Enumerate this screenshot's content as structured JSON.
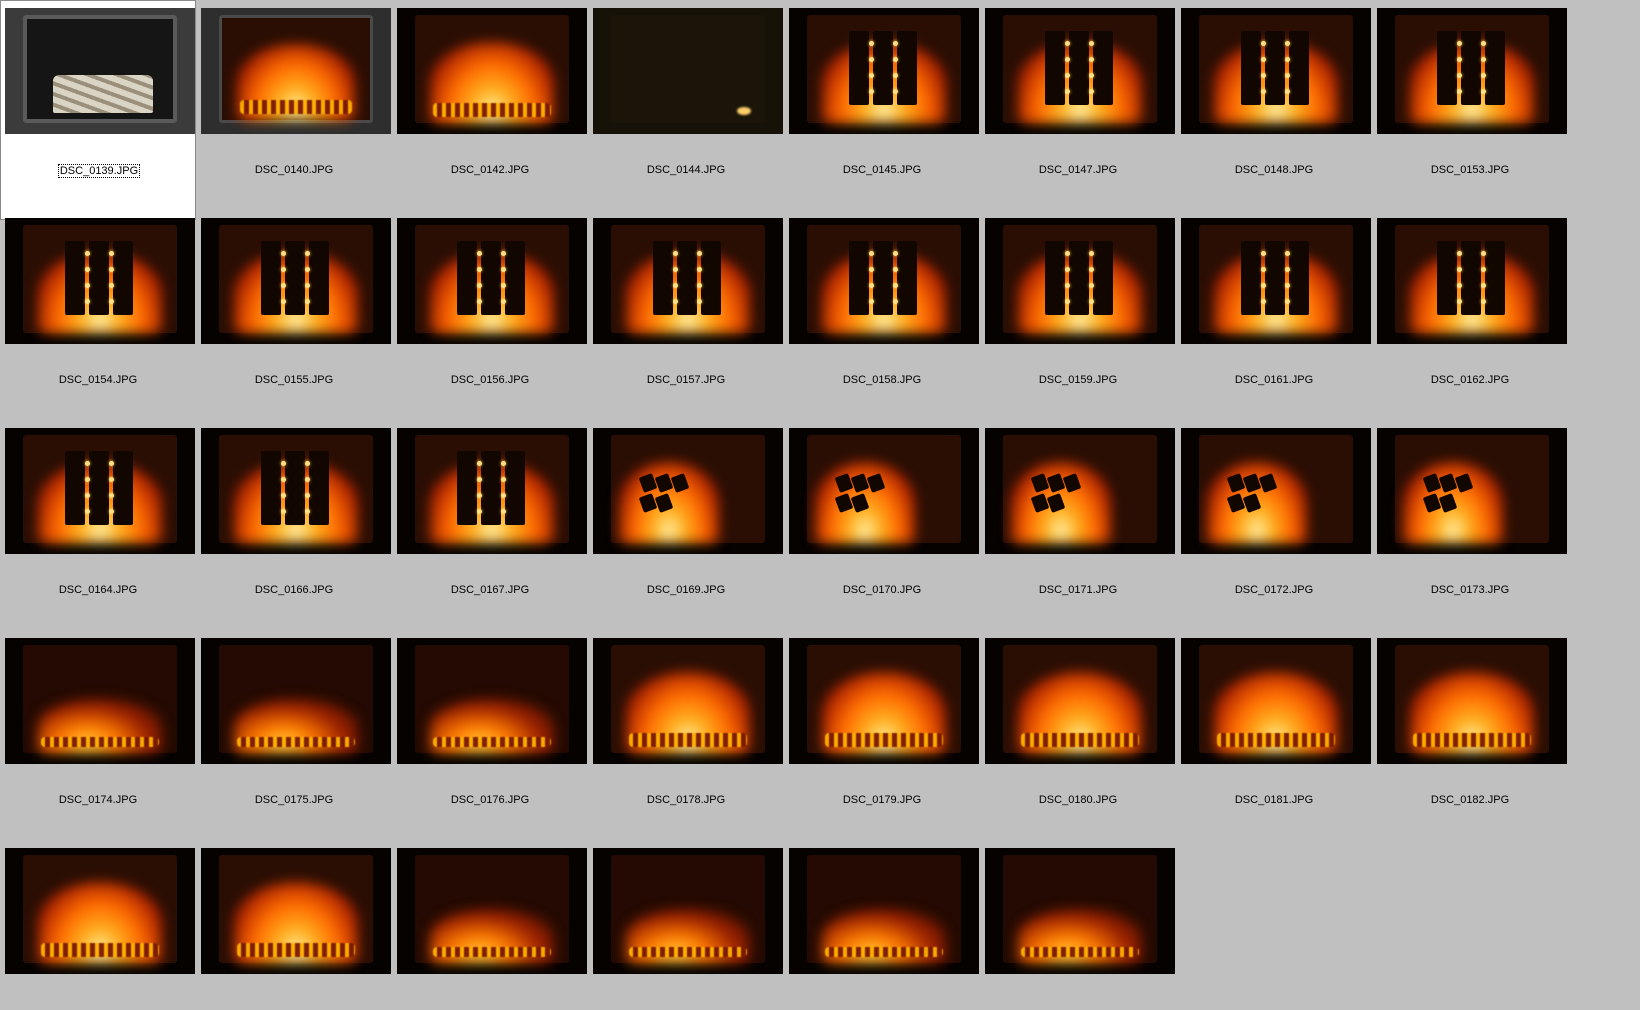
{
  "window": {
    "title": ""
  },
  "gallery": {
    "items": [
      {
        "name": "DSC_0139.JPG",
        "selected": true,
        "style": "wood"
      },
      {
        "name": "DSC_0140.JPG",
        "selected": false,
        "style": "startfire"
      },
      {
        "name": "DSC_0142.JPG",
        "selected": false,
        "style": "flame"
      },
      {
        "name": "DSC_0144.JPG",
        "selected": false,
        "style": "dark"
      },
      {
        "name": "DSC_0145.JPG",
        "selected": false,
        "style": "grid"
      },
      {
        "name": "DSC_0147.JPG",
        "selected": false,
        "style": "grid"
      },
      {
        "name": "DSC_0148.JPG",
        "selected": false,
        "style": "grid"
      },
      {
        "name": "DSC_0153.JPG",
        "selected": false,
        "style": "grid"
      },
      {
        "name": "DSC_0154.JPG",
        "selected": false,
        "style": "grid"
      },
      {
        "name": "DSC_0155.JPG",
        "selected": false,
        "style": "grid"
      },
      {
        "name": "DSC_0156.JPG",
        "selected": false,
        "style": "grid"
      },
      {
        "name": "DSC_0157.JPG",
        "selected": false,
        "style": "grid"
      },
      {
        "name": "DSC_0158.JPG",
        "selected": false,
        "style": "grid"
      },
      {
        "name": "DSC_0159.JPG",
        "selected": false,
        "style": "grid"
      },
      {
        "name": "DSC_0161.JPG",
        "selected": false,
        "style": "grid"
      },
      {
        "name": "DSC_0162.JPG",
        "selected": false,
        "style": "grid"
      },
      {
        "name": "DSC_0164.JPG",
        "selected": false,
        "style": "grid"
      },
      {
        "name": "DSC_0166.JPG",
        "selected": false,
        "style": "grid"
      },
      {
        "name": "DSC_0167.JPG",
        "selected": false,
        "style": "grid"
      },
      {
        "name": "DSC_0169.JPG",
        "selected": false,
        "style": "burn"
      },
      {
        "name": "DSC_0170.JPG",
        "selected": false,
        "style": "burn"
      },
      {
        "name": "DSC_0171.JPG",
        "selected": false,
        "style": "burn"
      },
      {
        "name": "DSC_0172.JPG",
        "selected": false,
        "style": "burn"
      },
      {
        "name": "DSC_0173.JPG",
        "selected": false,
        "style": "burn"
      },
      {
        "name": "DSC_0174.JPG",
        "selected": false,
        "style": "embers"
      },
      {
        "name": "DSC_0175.JPG",
        "selected": false,
        "style": "embers"
      },
      {
        "name": "DSC_0176.JPG",
        "selected": false,
        "style": "embers"
      },
      {
        "name": "DSC_0178.JPG",
        "selected": false,
        "style": "flame"
      },
      {
        "name": "DSC_0179.JPG",
        "selected": false,
        "style": "flame"
      },
      {
        "name": "DSC_0180.JPG",
        "selected": false,
        "style": "flame"
      },
      {
        "name": "DSC_0181.JPG",
        "selected": false,
        "style": "flame"
      },
      {
        "name": "DSC_0182.JPG",
        "selected": false,
        "style": "flame"
      },
      {
        "name": "",
        "selected": false,
        "style": "flame"
      },
      {
        "name": "",
        "selected": false,
        "style": "flame"
      },
      {
        "name": "",
        "selected": false,
        "style": "embers"
      },
      {
        "name": "",
        "selected": false,
        "style": "embers"
      },
      {
        "name": "",
        "selected": false,
        "style": "embers"
      },
      {
        "name": "",
        "selected": false,
        "style": "embers"
      }
    ]
  },
  "colors": {
    "background": "#c0c0c0",
    "selected_background": "#ffffff",
    "label_text": "#000000"
  }
}
